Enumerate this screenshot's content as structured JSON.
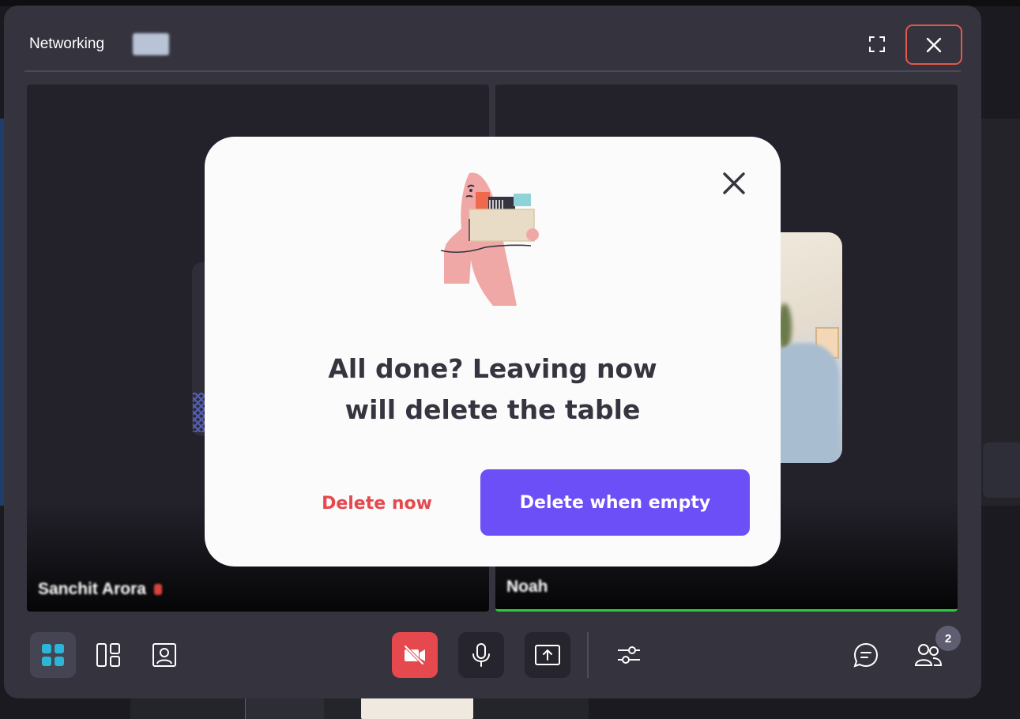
{
  "window": {
    "title": "Networking"
  },
  "participants": [
    {
      "name": "Sanchit Arora",
      "muted": true
    },
    {
      "name": "Noah",
      "speaking": true
    }
  ],
  "toolbar": {
    "participants_count": "2",
    "active_layout": "grid"
  },
  "modal": {
    "title_line1": "All done? Leaving now",
    "title_line2": "will delete the table",
    "delete_now_label": "Delete now",
    "delete_when_empty_label": "Delete when empty"
  },
  "colors": {
    "accent": "#6c4ff6",
    "danger": "#e5484d",
    "speaking": "#2ccb3a",
    "highlight_close": "#e2584a"
  }
}
